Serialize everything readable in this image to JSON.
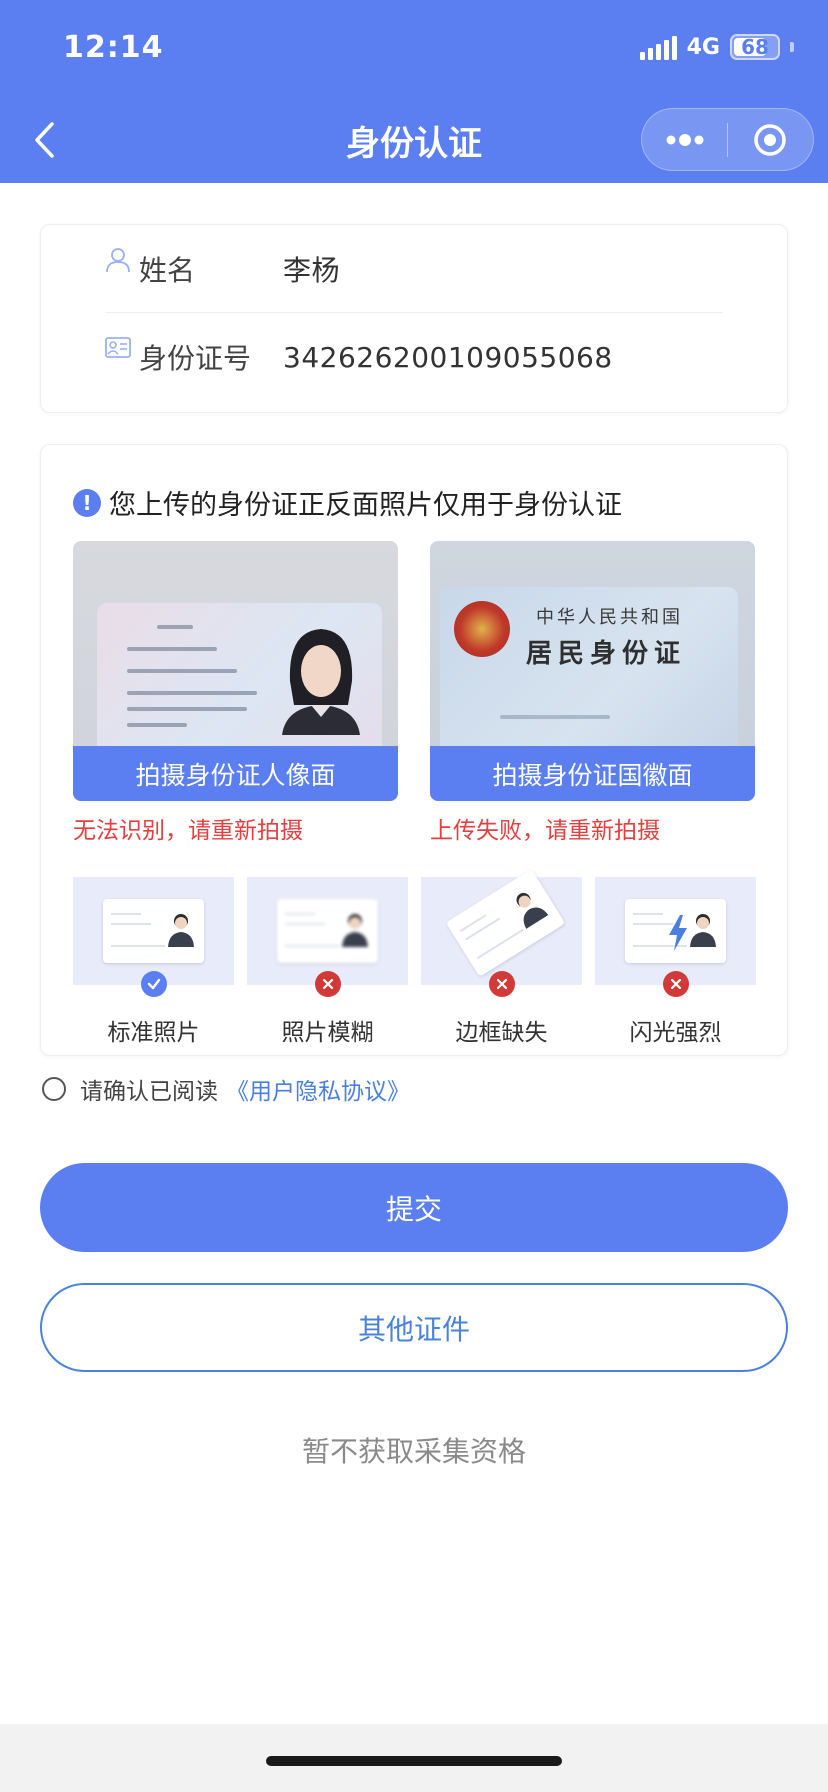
{
  "status_bar": {
    "time": "12:14",
    "network": "4G",
    "battery": "68"
  },
  "nav": {
    "title": "身份认证"
  },
  "colors": {
    "brand": "#5b7ff0",
    "error": "#e24040",
    "link": "#4a7fdf"
  },
  "identity": {
    "name_label": "姓名",
    "name_value": "李杨",
    "id_label": "身份证号",
    "id_value": "342626200109055068"
  },
  "upload": {
    "notice": "您上传的身份证正反面照片仅用于身份认证",
    "front": {
      "button_label": "拍摄身份证人像面",
      "error": "无法识别，请重新拍摄"
    },
    "back": {
      "title_line1": "中华人民共和国",
      "title_line2": "居民身份证",
      "button_label": "拍摄身份证国徽面",
      "error": "上传失败，请重新拍摄"
    },
    "examples": [
      {
        "label": "标准照片",
        "status": "ok",
        "icon": "check-icon"
      },
      {
        "label": "照片模糊",
        "status": "bad",
        "icon": "close-icon"
      },
      {
        "label": "边框缺失",
        "status": "bad",
        "icon": "close-icon"
      },
      {
        "label": "闪光强烈",
        "status": "bad",
        "icon": "close-icon"
      }
    ]
  },
  "agreement": {
    "text": "请确认已阅读",
    "link": "《用户隐私协议》"
  },
  "actions": {
    "submit": "提交",
    "other_documents": "其他证件",
    "skip": "暂不获取采集资格"
  }
}
